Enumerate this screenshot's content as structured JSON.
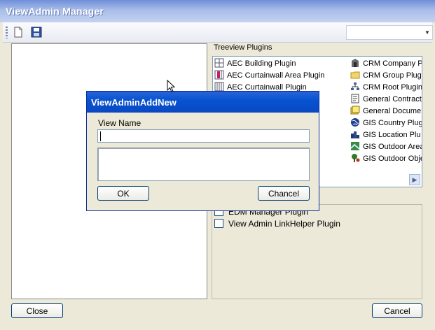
{
  "window": {
    "title": "ViewAdmin Manager"
  },
  "toolbar": {
    "new_icon": "new-document-icon",
    "save_icon": "save-disk-icon",
    "combo_value": ""
  },
  "plugins": {
    "label": "Treeview Plugins",
    "col1": [
      {
        "label": "AEC Building Plugin",
        "icon": "aec-building-icon"
      },
      {
        "label": "AEC Curtainwall Area Plugin",
        "icon": "aec-curtainwall-area-icon"
      },
      {
        "label": "AEC Curtainwall Plugin",
        "icon": "aec-curtainwall-icon"
      }
    ],
    "col2": [
      {
        "label": "CRM Company P",
        "icon": "crm-company-icon"
      },
      {
        "label": "CRM Group Plug",
        "icon": "folder-icon"
      },
      {
        "label": "CRM Root Plugin",
        "icon": "hierarchy-icon"
      },
      {
        "label": "General Contract",
        "icon": "contract-icon"
      },
      {
        "label": "General Docume",
        "icon": "document-icon"
      },
      {
        "label": "GIS Country Plug",
        "icon": "globe-icon"
      },
      {
        "label": "GIS Location Plu",
        "icon": "location-icon"
      },
      {
        "label": "GIS Outdoor Area",
        "icon": "outdoor-area-icon"
      },
      {
        "label": "GIS Outdoor Obje",
        "icon": "outdoor-object-icon"
      }
    ]
  },
  "other_plugins": [
    {
      "label": "EDM Manager Plugin",
      "checked": false
    },
    {
      "label": "View Admin LinkHelper Plugin",
      "checked": false
    }
  ],
  "buttons": {
    "close": "Close",
    "cancel": "Cancel"
  },
  "dialog": {
    "title": "ViewAdminAddNew",
    "view_name_label": "View Name",
    "view_name_value": "",
    "description_value": "",
    "ok": "OK",
    "cancel": "Chancel"
  }
}
